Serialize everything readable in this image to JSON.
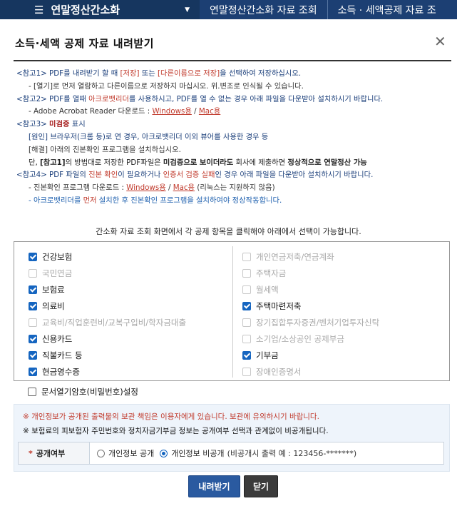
{
  "topnav": {
    "menu_icon": "hamburger-icon",
    "title": "연말정산간소화",
    "crumb1": "연말정산간소화 자료 조회",
    "crumb2": "소득 · 세액공제 자료 조"
  },
  "dialog": {
    "title": "소득·세액 공제 자료 내려받기",
    "close_icon": "close-icon"
  },
  "notes": {
    "n1_tag": "<참고1>",
    "n1_a": " PDF를 내려받기 할 때 ",
    "n1_b": "[저장]",
    "n1_c": " 또는 ",
    "n1_d": "[다른이름으로 저장]",
    "n1_e": "을 선택하여 저장하십시오.",
    "n1_sub": "- [열기]로 먼저 열람하고 다른이름으로 저장하지 마십시오. 위.변조로 인식될 수 있습니다.",
    "n2_tag": "<참고2>",
    "n2_a": " PDF를 열때 ",
    "n2_b": "아크로뱃리더",
    "n2_c": "를 사용하시고, PDF를 열 수 없는 경우 아래 파일을 다운받아 설치하시기 바랍니다.",
    "n2_sub_a": "- Adobe Acrobat Reader 다운로드 : ",
    "n2_link_win": "Windows용",
    "n2_slash": " / ",
    "n2_link_mac": "Mac용",
    "n3_tag": "<참고3>",
    "n3_a": " ",
    "n3_b": "미검증",
    "n3_c": " 표시",
    "n3_l1": "[원인] 브라우저(크롬 등)로 연 경우, 아크로뱃리더 이외 뷰어를 사용한 경우 등",
    "n3_l2": "[해결] 아래의 진본확인 프로그램을 설치하십시오.",
    "n3_l3_a": "단, ",
    "n3_l3_b": "[참고1]",
    "n3_l3_c": "의 방법대로 저장한 PDF파일은 ",
    "n3_l3_d": "미검증으로 보이더라도",
    "n3_l3_e": " 회사에 제출하면 ",
    "n3_l3_f": "정상적으로 연말정산 가능",
    "n4_tag": "<참고4>",
    "n4_a": " PDF 파일의 ",
    "n4_b": "진본 확인",
    "n4_c": "이 필요하거나 ",
    "n4_d": "인증서 검증 실패",
    "n4_e": "인 경우 아래 파일을 다운받아 설치하시기 바랍니다.",
    "n4_s1_a": "- 진본확인 프로그램 다운로드 : ",
    "n4_link_win": "Windows용",
    "n4_slash": " / ",
    "n4_link_mac": "Mac용",
    "n4_s1_b": " (리눅스는 지원하지 않음)",
    "n4_s2_a": "- 아크로뱃리더를 ",
    "n4_s2_b": "먼저",
    "n4_s2_c": " 설치한 후 진본확인 프로그램을 설치하여야 정상작동합니다."
  },
  "instruction": "간소화 자료 조회 화면에서 각 공제 항목을 클릭해야 아래에서 선택이 가능합니다.",
  "items_left": [
    {
      "label": "건강보험",
      "state": "checked"
    },
    {
      "label": "국민연금",
      "state": "disabled"
    },
    {
      "label": "보험료",
      "state": "checked"
    },
    {
      "label": "의료비",
      "state": "checked"
    },
    {
      "label": "교육비/직업훈련비/교복구입비/학자금대출",
      "state": "disabled"
    },
    {
      "label": "신용카드",
      "state": "checked"
    },
    {
      "label": "직불카드 등",
      "state": "checked"
    },
    {
      "label": "현금영수증",
      "state": "checked"
    }
  ],
  "items_right": [
    {
      "label": "개인연금저축/연금계좌",
      "state": "disabled"
    },
    {
      "label": "주택자금",
      "state": "disabled"
    },
    {
      "label": "월세액",
      "state": "disabled"
    },
    {
      "label": "주택마련저축",
      "state": "checked"
    },
    {
      "label": "장기집합투자증권/벤처기업투자신탁",
      "state": "disabled"
    },
    {
      "label": "소기업/소상공인 공제부금",
      "state": "disabled"
    },
    {
      "label": "기부금",
      "state": "checked"
    },
    {
      "label": "장애인증명서",
      "state": "disabled"
    }
  ],
  "password_option": "문서열기암호(비밀번호)설정",
  "privacy": {
    "warning1": "※ 개인정보가 공개된 출력물의 보관 책임은 이용자에게 있습니다. 보관에 유의하시기 바랍니다.",
    "warning2": "※ 보험료의 피보험자 주민번호와 정치자금기부금 정보는 공개여부 선택과 관계없이 비공개됩니다.",
    "row_star": "*",
    "row_label": "공개여부",
    "opt_public": "개인정보 공개",
    "opt_private": "개인정보 비공개",
    "example": "(비공개시 출력 예 : 123456-*******)",
    "selected": "private"
  },
  "buttons": {
    "download": "내려받기",
    "close": "닫기"
  },
  "colors": {
    "nav_bg": "#1c3f73",
    "accent_blue": "#1565c0",
    "warning_red": "#c0392b",
    "download_btn": "#2a5aa0",
    "close_btn": "#3b3b3b"
  }
}
